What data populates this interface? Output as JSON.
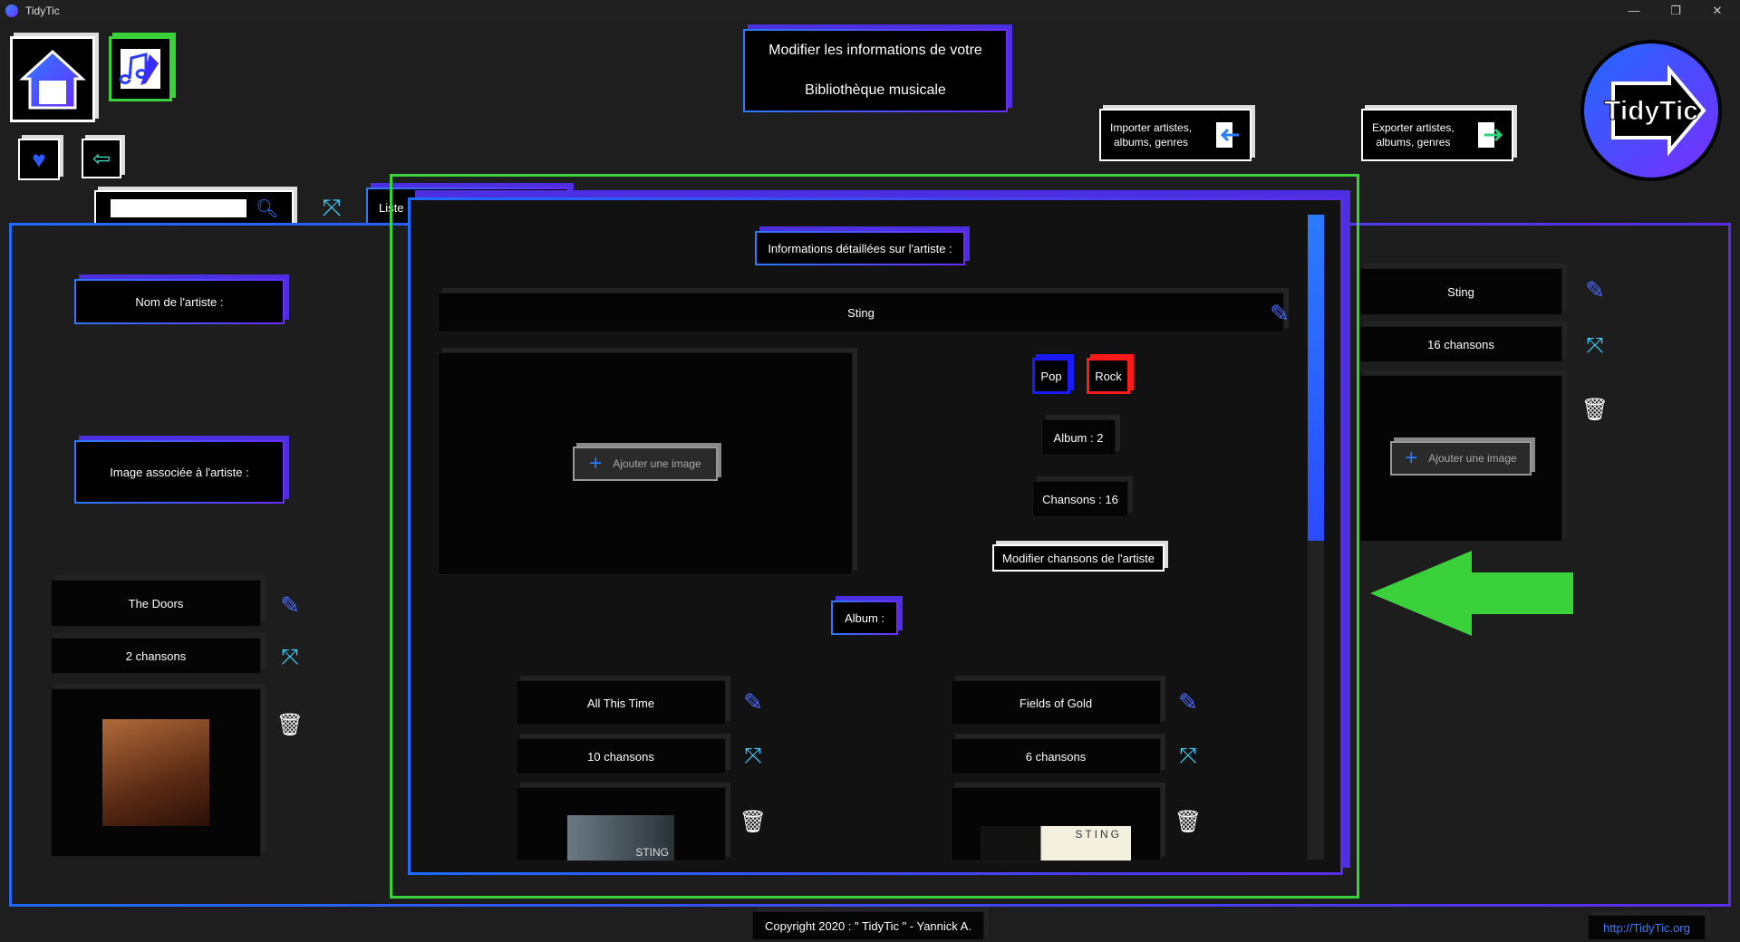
{
  "window": {
    "title": "TidyTic",
    "minimize": "—",
    "restore": "❐",
    "close": "✕"
  },
  "header": {
    "title_line1": "Modifier les informations de votre",
    "title_line2": "Bibliothèque musicale",
    "import_label_1": "Importer artistes,",
    "import_label_2": "albums, genres",
    "export_label_1": "Exporter artistes,",
    "export_label_2": "albums, genres",
    "logo_text": "TidyTic"
  },
  "search": {
    "placeholder": "",
    "value": ""
  },
  "tab_label": "Liste",
  "left_panel": {
    "artist_name_label": "Nom de l'artiste :",
    "artist_image_label": "Image associée à l'artiste :",
    "card": {
      "name": "The Doors",
      "count": "2 chansons"
    }
  },
  "right_panel": {
    "card": {
      "name": "Sting",
      "count": "16 chansons",
      "add_image": "Ajouter une image"
    }
  },
  "detail": {
    "heading": "Informations détaillées sur l'artiste :",
    "artist_name": "Sting",
    "add_image": "Ajouter une image",
    "genres": [
      {
        "label": "Pop",
        "color": "#1a1aff"
      },
      {
        "label": "Rock",
        "color": "#ff1a1a"
      }
    ],
    "album_count": "Album  : 2",
    "song_count": "Chansons  : 16",
    "edit_songs": "Modifier chansons de l'artiste",
    "album_heading": "Album  :",
    "albums": [
      {
        "name": "All This Time",
        "count": "10 chansons",
        "cover_text": "STING"
      },
      {
        "name": "Fields of Gold",
        "count": "6 chansons",
        "cover_text": "STING"
      }
    ]
  },
  "footer": {
    "copyright": "Copyright 2020 : \" TidyTic \" - Yannick A.",
    "link": "http://TidyTic.org"
  },
  "colors": {
    "accent_blue": "#2b7bff",
    "accent_purple": "#6a2cff",
    "highlight_green": "#3bd13b"
  }
}
